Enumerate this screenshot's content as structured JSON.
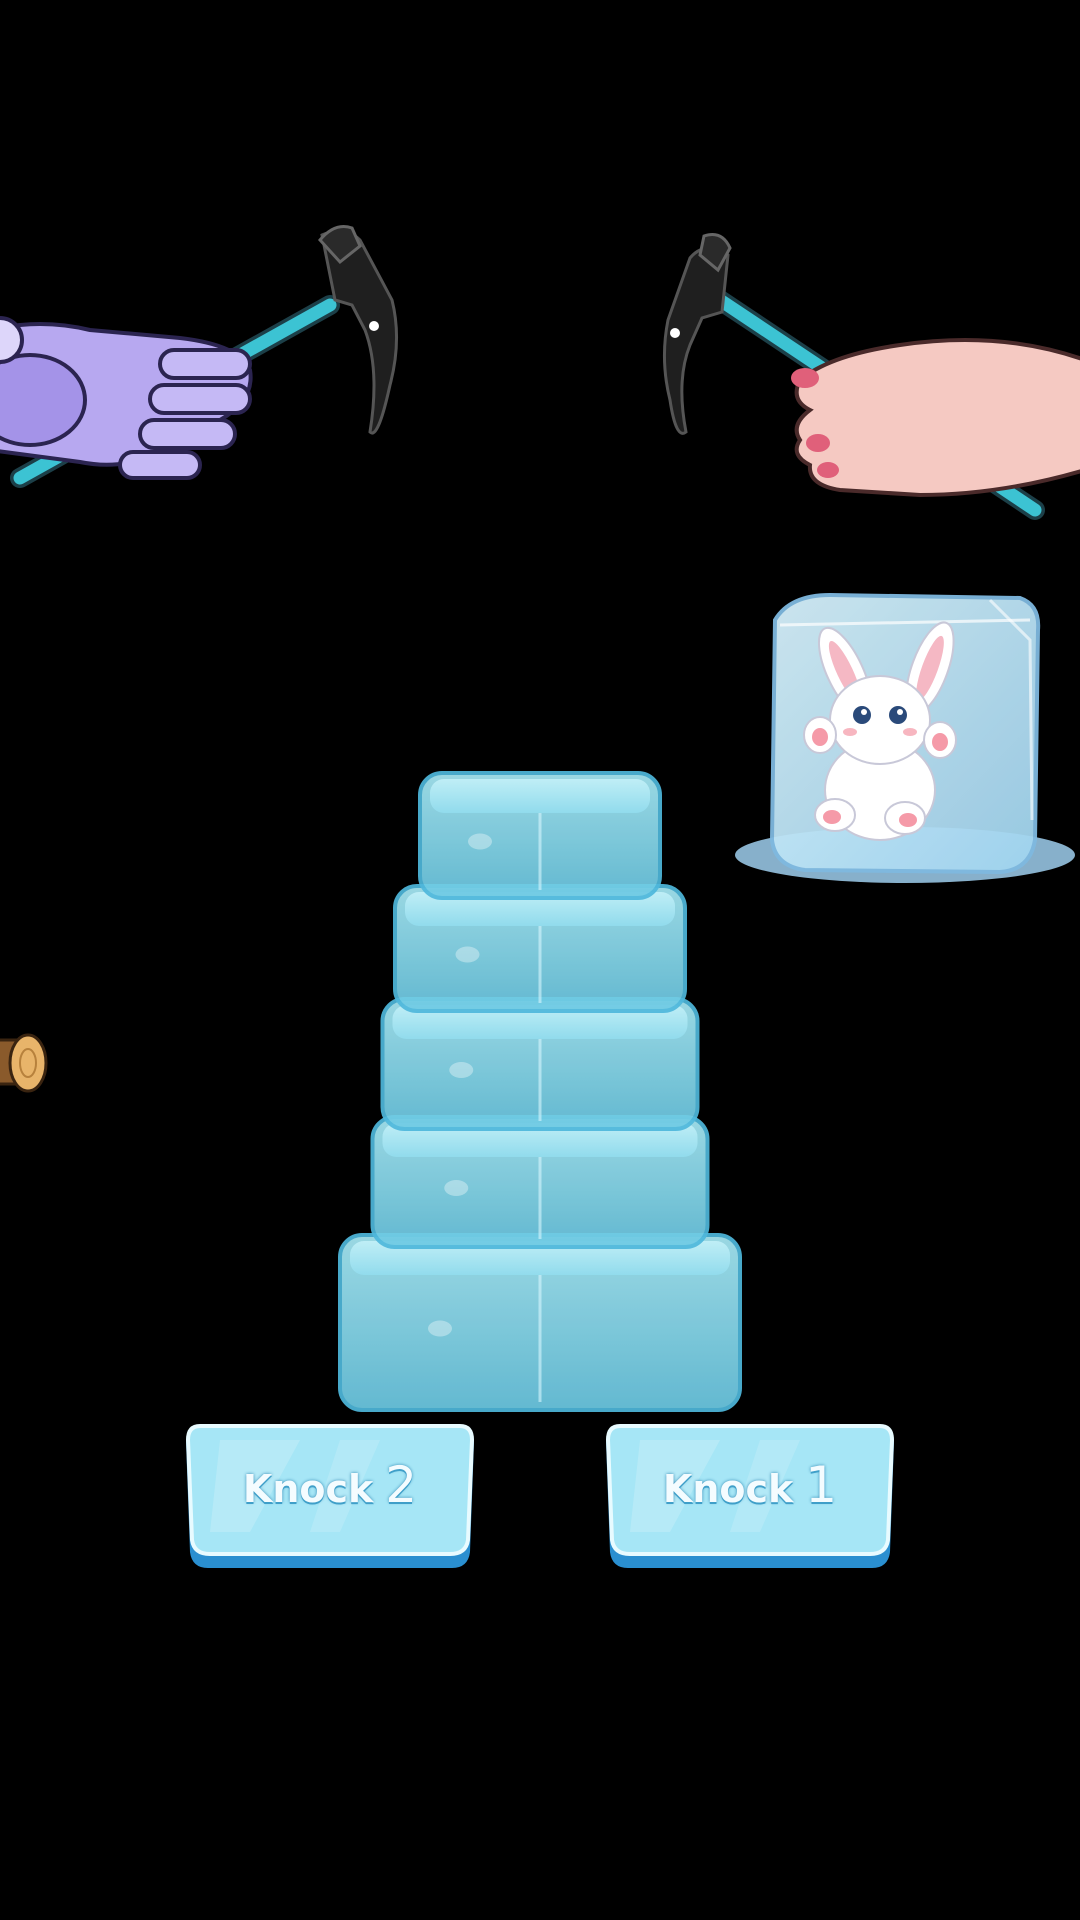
{
  "buttons": [
    {
      "id": "knock-2",
      "label": "Knock",
      "value": "2"
    },
    {
      "id": "knock-1",
      "label": "Knock",
      "value": "1"
    }
  ],
  "ice_tower": {
    "block_count": 5
  },
  "characters": {
    "left_hand": "robot-hand",
    "right_hand": "human-hand",
    "frozen_animal": "bunny"
  },
  "icons": {
    "left_tool": "ice-axe-icon",
    "right_tool": "ice-axe-icon",
    "edge_item": "wood-log-icon"
  },
  "colors": {
    "background": "#000000",
    "ice": "#8fdcef",
    "ice_edge": "#4fb8dc",
    "robot": "#b7a8f0",
    "skin": "#f5c9c2",
    "axe_handle": "#3cc3d3",
    "axe_head": "#222222"
  }
}
